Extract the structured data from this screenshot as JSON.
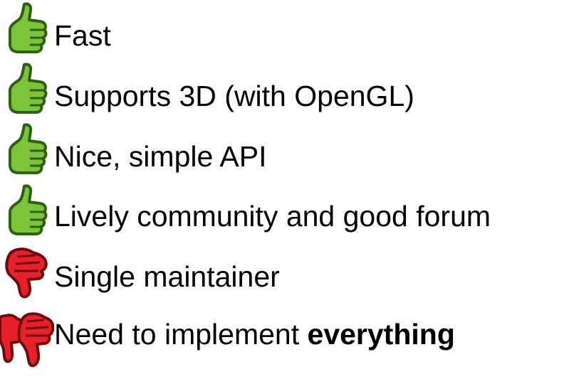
{
  "items": [
    {
      "kind": "pro",
      "icon": "thumbs-up-icon",
      "text": "Fast",
      "strong": ""
    },
    {
      "kind": "pro",
      "icon": "thumbs-up-icon",
      "text": "Supports 3D (with OpenGL)",
      "strong": ""
    },
    {
      "kind": "pro",
      "icon": "thumbs-up-icon",
      "text": "Nice, simple API",
      "strong": ""
    },
    {
      "kind": "pro",
      "icon": "thumbs-up-icon",
      "text": "Lively community and good forum",
      "strong": ""
    },
    {
      "kind": "con",
      "icon": "thumbs-down-icon",
      "text": "Single maintainer",
      "strong": ""
    },
    {
      "kind": "con",
      "icon": "double-thumbs-down-icon",
      "text": "Need to implement ",
      "strong": "everything"
    }
  ],
  "colors": {
    "pro_fill": "#7cc43a",
    "pro_stroke": "#2f5f12",
    "con_fill": "#e8202a",
    "con_stroke": "#6e0a0e"
  }
}
